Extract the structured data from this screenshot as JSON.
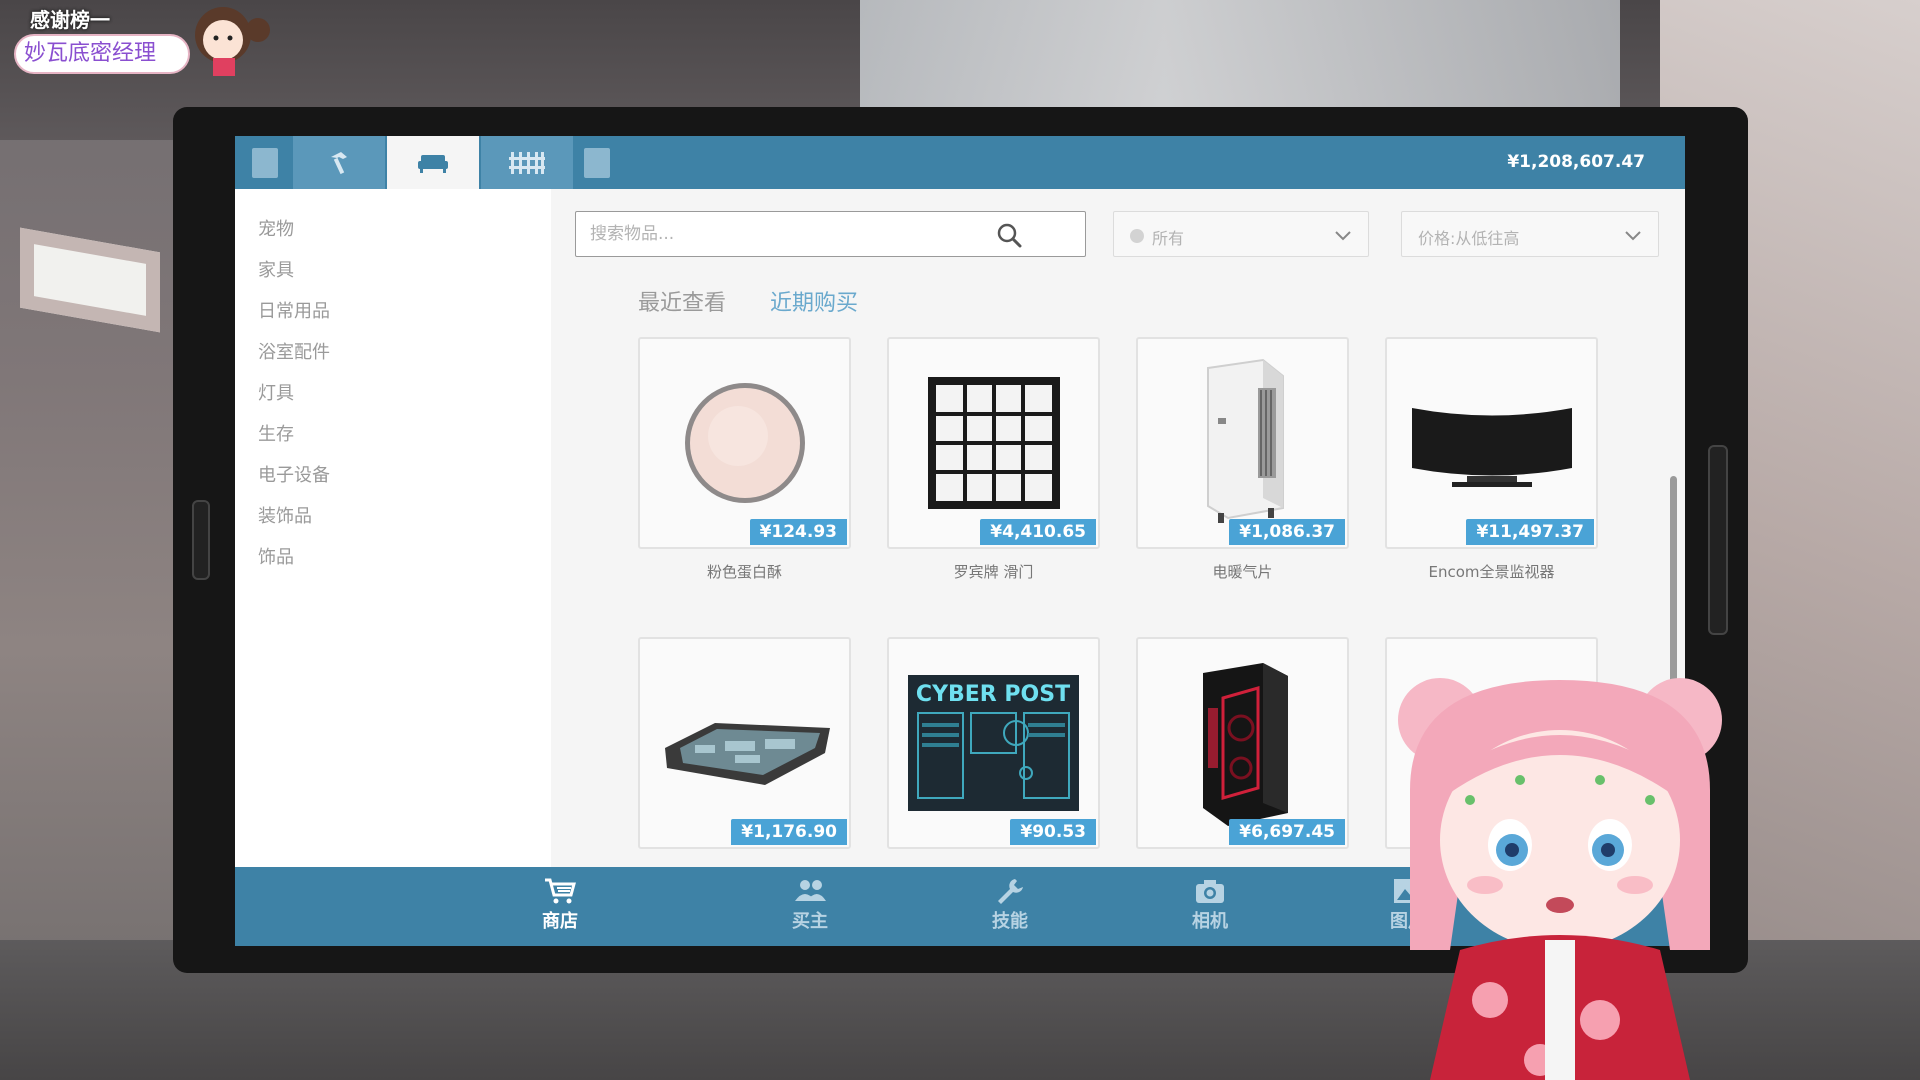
{
  "topbar": {
    "balance": "¥1,208,607.47",
    "tabs": [
      {
        "icon": "hammer-icon",
        "active": false
      },
      {
        "icon": "sofa-icon",
        "active": true
      },
      {
        "icon": "fence-icon",
        "active": false
      }
    ]
  },
  "sidebar": {
    "categories": [
      "宠物",
      "家具",
      "日常用品",
      "浴室配件",
      "灯具",
      "生存",
      "电子设备",
      "装饰品",
      "饰品"
    ]
  },
  "search": {
    "placeholder": "搜索物品...",
    "filter_label": "所有",
    "sort_label": "价格:从低往高"
  },
  "tabs": {
    "recent": "最近查看",
    "purchase": "近期购买"
  },
  "products": [
    {
      "name": "粉色蛋白酥",
      "price": "¥124.93",
      "icon": "pink-meringue-icon"
    },
    {
      "name": "罗宾牌 滑门",
      "price": "¥4,410.65",
      "icon": "sliding-door-icon"
    },
    {
      "name": "电暖气片",
      "price": "¥1,086.37",
      "icon": "heater-icon"
    },
    {
      "name": "Encom全景监视器",
      "price": "¥11,497.37",
      "icon": "curved-monitor-icon"
    },
    {
      "name": "",
      "price": "¥1,176.90",
      "icon": "keyboard-deck-icon"
    },
    {
      "name": "",
      "price": "¥90.53",
      "icon": "cyber-post-poster-icon",
      "poster_text": "CYBER POST"
    },
    {
      "name": "",
      "price": "¥6,697.45",
      "icon": "pc-tower-icon"
    },
    {
      "name": "",
      "price": "",
      "icon": ""
    }
  ],
  "bottom_nav": [
    {
      "label": "商店",
      "icon": "cart-icon",
      "active": true
    },
    {
      "label": "买主",
      "icon": "users-icon",
      "active": false
    },
    {
      "label": "技能",
      "icon": "wrench-icon",
      "active": false
    },
    {
      "label": "相机",
      "icon": "camera-icon",
      "active": false
    },
    {
      "label": "图片",
      "icon": "image-icon",
      "active": false
    }
  ],
  "overlay": {
    "thanks_title": "感谢榜一",
    "thanks_name": "妙瓦底密经理"
  }
}
